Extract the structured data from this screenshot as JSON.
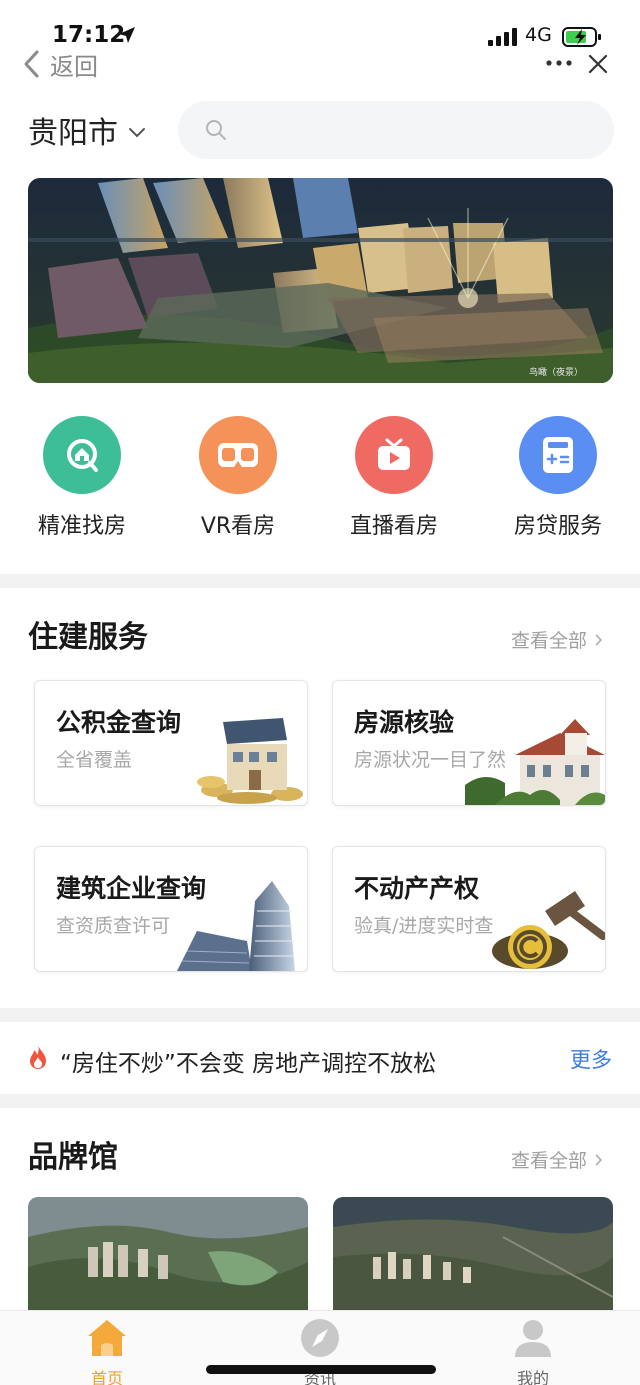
{
  "status_bar": {
    "time": "17:12",
    "network": "4G"
  },
  "nav": {
    "back_label": "返回"
  },
  "header": {
    "city": "贵阳市",
    "search_placeholder": ""
  },
  "banner": {
    "caption": "鸟瞰（夜景）"
  },
  "quick_entries": [
    {
      "label": "精准找房",
      "icon": "house-search-icon",
      "color": "#3dbe96"
    },
    {
      "label": "VR看房",
      "icon": "vr-goggles-icon",
      "color": "#f5925a"
    },
    {
      "label": "直播看房",
      "icon": "tv-play-icon",
      "color": "#ef6a63"
    },
    {
      "label": "房贷服务",
      "icon": "calculator-icon",
      "color": "#5b8ef2"
    }
  ],
  "housing_services": {
    "title": "住建服务",
    "more_label": "查看全部",
    "cards": [
      {
        "title": "公积金查询",
        "subtitle": "全省覆盖"
      },
      {
        "title": "房源核验",
        "subtitle": "房源状况一目了然"
      },
      {
        "title": "建筑企业查询",
        "subtitle": "查资质查许可"
      },
      {
        "title": "不动产产权",
        "subtitle": "验真/进度实时查"
      }
    ]
  },
  "news": {
    "headline": "“房住不炒”不会变 房地产调控不放松",
    "more_label": "更多"
  },
  "brand": {
    "title": "品牌馆",
    "more_label": "查看全部"
  },
  "tabbar": {
    "active_color": "#f0a030",
    "items": [
      {
        "label": "首页",
        "icon": "home-icon",
        "active": true
      },
      {
        "label": "资讯",
        "icon": "compass-icon",
        "active": false
      },
      {
        "label": "我的",
        "icon": "user-icon",
        "active": false
      }
    ]
  }
}
